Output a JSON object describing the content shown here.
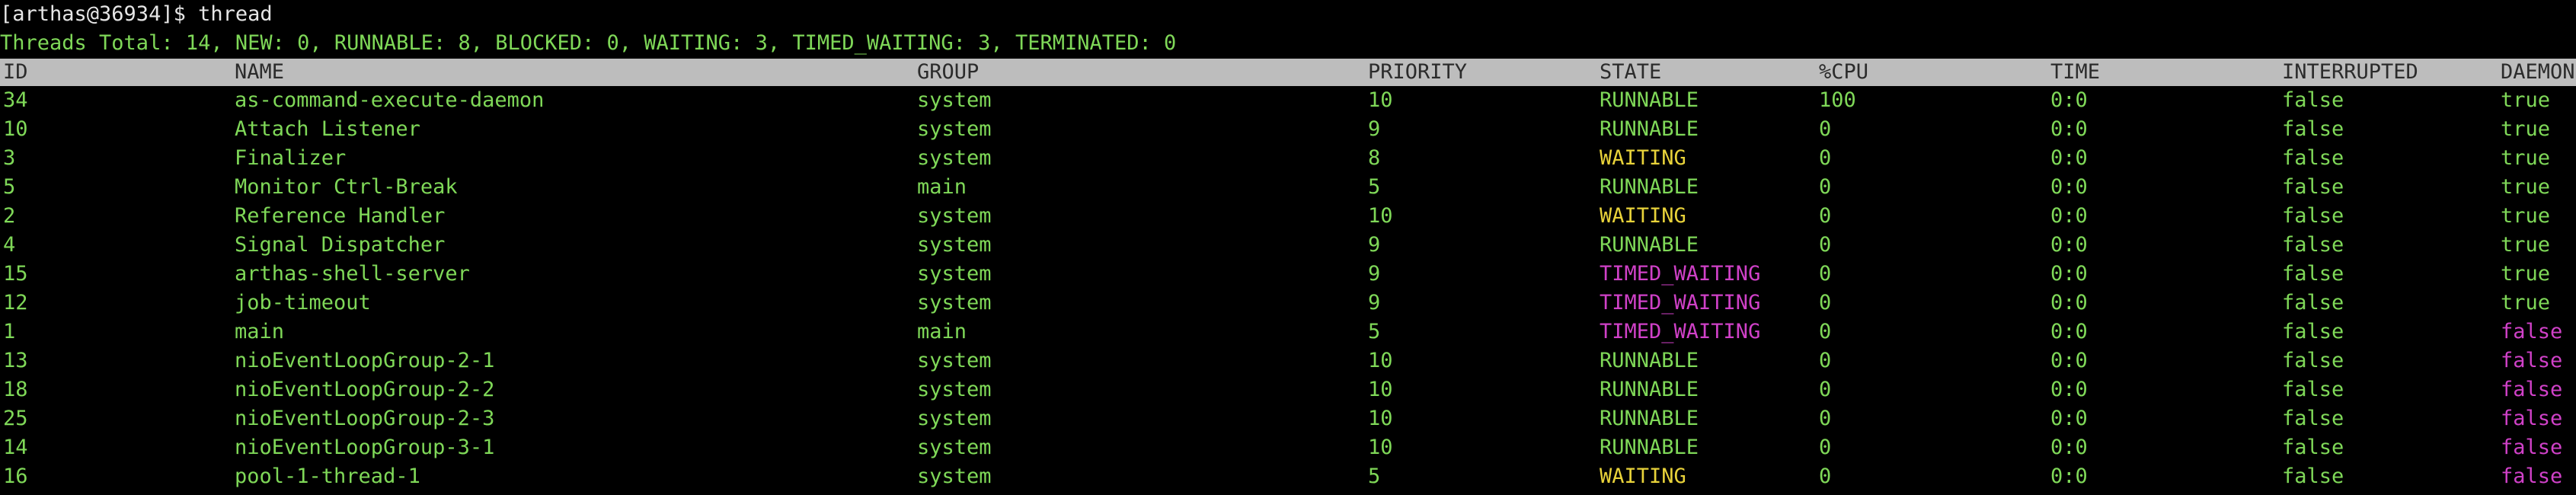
{
  "terminal": {
    "prompt": "[arthas@36934]$ thread",
    "summary": "Threads Total: 14, NEW: 0, RUNNABLE: 8, BLOCKED: 0, WAITING: 3, TIMED_WAITING: 3, TERMINATED: 0"
  },
  "colors": {
    "background": "#000000",
    "text_green": "#7fd858",
    "waiting_yellow": "#e8d23a",
    "timed_waiting_magenta": "#d041c8",
    "header_bg": "#bdbdbd",
    "header_text": "#2b2b2b"
  },
  "table": {
    "headers": {
      "id": "ID",
      "name": "NAME",
      "group": "GROUP",
      "priority": "PRIORITY",
      "state": "STATE",
      "cpu": "%CPU",
      "time": "TIME",
      "interrupted": "INTERRUPTED",
      "daemon": "DAEMON"
    },
    "rows": [
      {
        "id": "34",
        "name": "as-command-execute-daemon",
        "group": "system",
        "priority": "10",
        "state": "RUNNABLE",
        "cpu": "100",
        "time": "0:0",
        "interrupted": "false",
        "daemon": "true"
      },
      {
        "id": "10",
        "name": "Attach Listener",
        "group": "system",
        "priority": "9",
        "state": "RUNNABLE",
        "cpu": "0",
        "time": "0:0",
        "interrupted": "false",
        "daemon": "true"
      },
      {
        "id": "3",
        "name": "Finalizer",
        "group": "system",
        "priority": "8",
        "state": "WAITING",
        "cpu": "0",
        "time": "0:0",
        "interrupted": "false",
        "daemon": "true"
      },
      {
        "id": "5",
        "name": "Monitor Ctrl-Break",
        "group": "main",
        "priority": "5",
        "state": "RUNNABLE",
        "cpu": "0",
        "time": "0:0",
        "interrupted": "false",
        "daemon": "true"
      },
      {
        "id": "2",
        "name": "Reference Handler",
        "group": "system",
        "priority": "10",
        "state": "WAITING",
        "cpu": "0",
        "time": "0:0",
        "interrupted": "false",
        "daemon": "true"
      },
      {
        "id": "4",
        "name": "Signal Dispatcher",
        "group": "system",
        "priority": "9",
        "state": "RUNNABLE",
        "cpu": "0",
        "time": "0:0",
        "interrupted": "false",
        "daemon": "true"
      },
      {
        "id": "15",
        "name": "arthas-shell-server",
        "group": "system",
        "priority": "9",
        "state": "TIMED_WAITING",
        "cpu": "0",
        "time": "0:0",
        "interrupted": "false",
        "daemon": "true"
      },
      {
        "id": "12",
        "name": "job-timeout",
        "group": "system",
        "priority": "9",
        "state": "TIMED_WAITING",
        "cpu": "0",
        "time": "0:0",
        "interrupted": "false",
        "daemon": "true"
      },
      {
        "id": "1",
        "name": "main",
        "group": "main",
        "priority": "5",
        "state": "TIMED_WAITING",
        "cpu": "0",
        "time": "0:0",
        "interrupted": "false",
        "daemon": "false"
      },
      {
        "id": "13",
        "name": "nioEventLoopGroup-2-1",
        "group": "system",
        "priority": "10",
        "state": "RUNNABLE",
        "cpu": "0",
        "time": "0:0",
        "interrupted": "false",
        "daemon": "false"
      },
      {
        "id": "18",
        "name": "nioEventLoopGroup-2-2",
        "group": "system",
        "priority": "10",
        "state": "RUNNABLE",
        "cpu": "0",
        "time": "0:0",
        "interrupted": "false",
        "daemon": "false"
      },
      {
        "id": "25",
        "name": "nioEventLoopGroup-2-3",
        "group": "system",
        "priority": "10",
        "state": "RUNNABLE",
        "cpu": "0",
        "time": "0:0",
        "interrupted": "false",
        "daemon": "false"
      },
      {
        "id": "14",
        "name": "nioEventLoopGroup-3-1",
        "group": "system",
        "priority": "10",
        "state": "RUNNABLE",
        "cpu": "0",
        "time": "0:0",
        "interrupted": "false",
        "daemon": "false"
      },
      {
        "id": "16",
        "name": "pool-1-thread-1",
        "group": "system",
        "priority": "5",
        "state": "WAITING",
        "cpu": "0",
        "time": "0:0",
        "interrupted": "false",
        "daemon": "false"
      }
    ]
  }
}
